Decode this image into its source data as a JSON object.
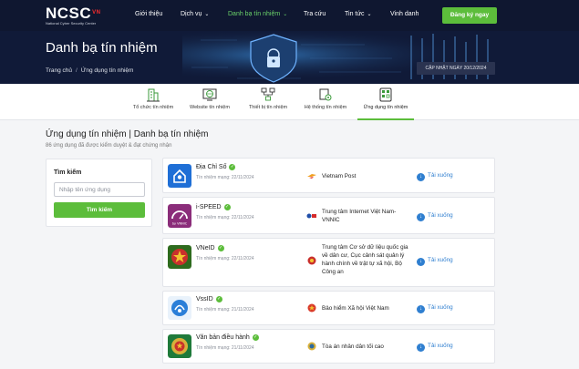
{
  "header": {
    "logo_text": "NCSC",
    "logo_suffix": "VN",
    "logo_subtitle": "National Cyber Security Center",
    "nav": [
      {
        "label": "Giới thiệu",
        "has_dropdown": false
      },
      {
        "label": "Dịch vụ",
        "has_dropdown": true
      },
      {
        "label": "Danh bạ tín nhiệm",
        "has_dropdown": true,
        "active": true
      },
      {
        "label": "Tra cứu",
        "has_dropdown": false
      },
      {
        "label": "Tin tức",
        "has_dropdown": true
      },
      {
        "label": "Vinh danh",
        "has_dropdown": false
      }
    ],
    "register_label": "Đăng ký ngay"
  },
  "hero": {
    "title": "Danh bạ tín nhiệm",
    "breadcrumb": [
      "Trang chủ",
      "Ứng dụng tín nhiệm"
    ],
    "update_label": "CẬP NHẬT NGÀY 20/12/2024"
  },
  "tabs": [
    {
      "label": "Tổ chức tín nhiệm",
      "icon": "building-icon"
    },
    {
      "label": "Website tín nhiệm",
      "icon": "globe-icon"
    },
    {
      "label": "Thiết bị tín nhiệm",
      "icon": "device-network-icon"
    },
    {
      "label": "Hệ thống tín nhiệm",
      "icon": "system-cog-icon"
    },
    {
      "label": "Ứng dụng tín nhiệm",
      "icon": "app-grid-icon",
      "active": true
    }
  ],
  "section": {
    "title": "Ứng dụng tín nhiệm | Danh bạ tín nhiệm",
    "subtitle": "86 ứng dụng đã được kiểm duyệt & đạt chứng nhận"
  },
  "search": {
    "label": "Tìm kiếm",
    "placeholder": "Nhập tên ứng dụng",
    "button_label": "Tìm kiếm"
  },
  "apps": [
    {
      "name": "Địa Chỉ Số",
      "date": "Tín nhiệm mạng: 22/11/2024",
      "org": "Vietnam Post",
      "download": "Tải xuống",
      "logo_color": "#1f6fd6"
    },
    {
      "name": "i-SPEED",
      "date": "Tín nhiệm mạng: 22/11/2024",
      "org": "Trung tâm Internet Việt Nam-VNNIC",
      "download": "Tải xuống",
      "logo_color": "#8b2d7a",
      "logo_caption": "by VNNIC"
    },
    {
      "name": "VNeID",
      "date": "Tín nhiệm mạng: 22/11/2024",
      "org": "Trung tâm Cơ sở dữ liệu quốc gia về dân cư, Cục cảnh sát quản lý hành chính về trật tự xã hội, Bộ Công an",
      "download": "Tải xuống",
      "logo_color": "#2e6b1e"
    },
    {
      "name": "VssID",
      "date": "Tín nhiệm mạng: 21/11/2024",
      "org": "Bảo hiểm Xã hội Việt Nam",
      "download": "Tải xuống",
      "logo_color": "#2b7fd8"
    },
    {
      "name": "Văn bản điều hành",
      "date": "Tín nhiệm mạng: 21/11/2024",
      "org": "Tòa án nhân dân tối cao",
      "download": "Tải xuống",
      "logo_color": "#1f7a3a"
    }
  ],
  "colors": {
    "brand_green": "#5cbd3b",
    "header_bg": "#0f1730",
    "link_blue": "#2f7fd0"
  }
}
